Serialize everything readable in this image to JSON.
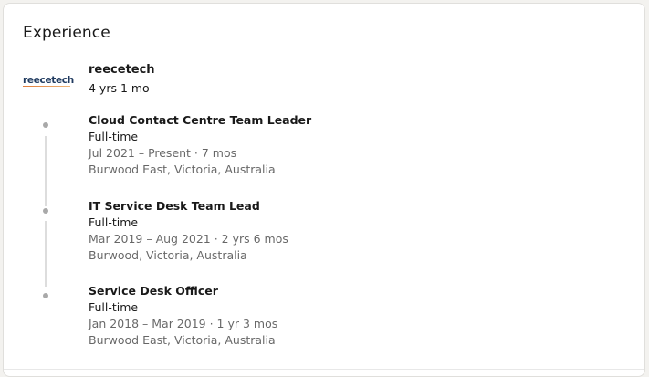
{
  "section": {
    "title": "Experience"
  },
  "company": {
    "logo_text": "reecetech",
    "name": "reecetech",
    "duration": "4 yrs 1 mo"
  },
  "roles": [
    {
      "title": "Cloud Contact Centre Team Leader",
      "type": "Full-time",
      "dates": "Jul 2021 – Present · 7 mos",
      "location": "Burwood East, Victoria, Australia"
    },
    {
      "title": "IT Service Desk Team Lead",
      "type": "Full-time",
      "dates": "Mar 2019 – Aug 2021 · 2 yrs 6 mos",
      "location": "Burwood, Victoria, Australia"
    },
    {
      "title": "Service Desk Officer",
      "type": "Full-time",
      "dates": "Jan 2018 – Mar 2019 · 1 yr 3 mos",
      "location": "Burwood East, Victoria, Australia"
    }
  ]
}
